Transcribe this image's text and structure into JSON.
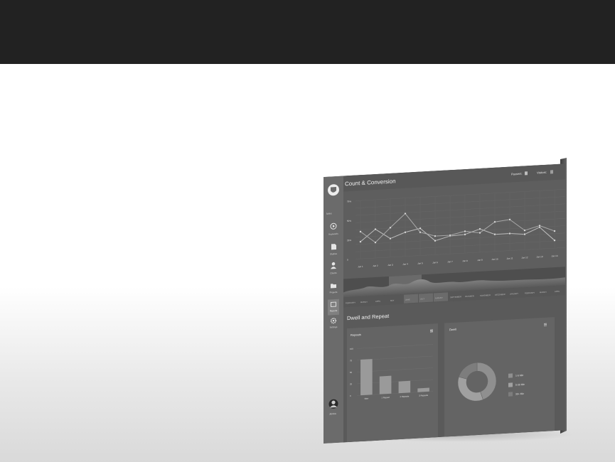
{
  "sidebar": {
    "brand_label": "lorex",
    "items": [
      {
        "label": "Keywords",
        "icon": "play-circle-icon"
      },
      {
        "label": "Studies",
        "icon": "document-icon"
      },
      {
        "label": "Clients",
        "icon": "person-icon"
      },
      {
        "label": "Projects",
        "icon": "folder-icon"
      },
      {
        "label": "Reports",
        "icon": "chart-box-icon"
      },
      {
        "label": "Settings",
        "icon": "gear-icon"
      }
    ],
    "user_label": "JENNA"
  },
  "count_panel": {
    "title": "Count & Conversion",
    "legend": [
      {
        "label": "Passers:",
        "color": "#bdbdbd"
      },
      {
        "label": "Visitors:",
        "color": "#9e9e9e"
      }
    ],
    "chart_data": {
      "type": "line",
      "x": [
        "Jun 1",
        "Jun 2",
        "Jun 3",
        "Jun 4",
        "Jun 5",
        "Jun 6",
        "Jun 7",
        "Jun 8",
        "Jun 9",
        "Jun 10",
        "Jun 11",
        "Jun 12",
        "Jun 13",
        "Jun 14"
      ],
      "yticks": [
        "75%",
        "50%",
        "25%",
        "0"
      ],
      "ylim": [
        0,
        75
      ],
      "series": [
        {
          "values": [
            22,
            37,
            24,
            31,
            35,
            18,
            23,
            24,
            30,
            22,
            22,
            20,
            28,
            10
          ]
        },
        {
          "values": [
            35,
            20,
            38,
            55,
            30,
            24,
            24,
            28,
            25,
            38,
            40,
            25,
            30,
            22
          ]
        }
      ],
      "grid": true
    }
  },
  "timeline": {
    "months": [
      "FEBRUARY",
      "MARCH",
      "APRIL",
      "MAY",
      "JUNE",
      "JULY",
      "AUGUST",
      "SEPTEMBER",
      "OCTOBER",
      "NOVEMBER",
      "DECEMBER",
      "JANUARY",
      "FEBRUARY",
      "MARCH",
      "APRIL"
    ],
    "selected": [
      "JUNE",
      "JULY",
      "AUGUST"
    ]
  },
  "dwell_section": {
    "title": "Dwell and Repeat",
    "repeats_card": {
      "title": "Repeats",
      "chart_data": {
        "type": "bar",
        "categories": [
          "New",
          "1 Repeat",
          "2 Repeats",
          "3 Repeats"
        ],
        "values": [
          76,
          38,
          25,
          8
        ],
        "yticks": [
          "100",
          "75",
          "50",
          "25",
          "0"
        ],
        "ylim": [
          0,
          100
        ]
      }
    },
    "dwell_card": {
      "title": "Dwell",
      "chart_data": {
        "type": "pie",
        "labels": [
          "1-5 Min",
          "5-30 Min",
          "30+ Min"
        ],
        "values": [
          45,
          35,
          20
        ]
      }
    }
  }
}
